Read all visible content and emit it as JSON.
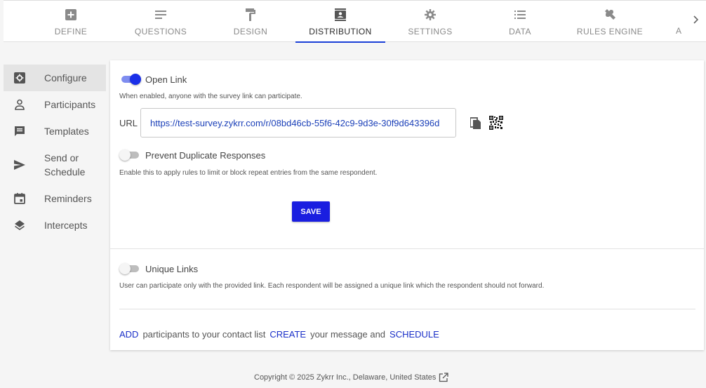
{
  "top_tabs": [
    {
      "label": "DEFINE",
      "icon": "plus-box-icon"
    },
    {
      "label": "QUESTIONS",
      "icon": "lines-icon"
    },
    {
      "label": "DESIGN",
      "icon": "paint-roller-icon"
    },
    {
      "label": "DISTRIBUTION",
      "icon": "contact-card-icon",
      "active": true
    },
    {
      "label": "SETTINGS",
      "icon": "gear-icon"
    },
    {
      "label": "DATA",
      "icon": "list-icon"
    },
    {
      "label": "RULES ENGINE",
      "icon": "wrench-icon"
    }
  ],
  "top_tab_partial": "A",
  "sidebar": {
    "items": [
      {
        "label": "Configure",
        "icon": "gear-box-icon",
        "active": true
      },
      {
        "label": "Participants",
        "icon": "person-icon"
      },
      {
        "label": "Templates",
        "icon": "message-icon"
      },
      {
        "label": "Send or Schedule",
        "icon": "send-icon"
      },
      {
        "label": "Reminders",
        "icon": "calendar-icon"
      },
      {
        "label": "Intercepts",
        "icon": "layers-icon"
      }
    ]
  },
  "main": {
    "open_link": {
      "label": "Open Link",
      "enabled": true,
      "hint": "When enabled, anyone with the survey link can participate."
    },
    "url_label": "URL",
    "url_value": "https://test-survey.zykrr.com/r/08bd46cb-55f6-42c9-9d3e-30f9d643396d",
    "prevent_duplicates": {
      "label": "Prevent Duplicate Responses",
      "enabled": false,
      "hint": "Enable this to apply rules to limit or block repeat entries from the same respondent."
    },
    "save_label": "SAVE",
    "unique_links": {
      "label": "Unique Links",
      "enabled": false,
      "hint": "User can participate only with the provided link. Each respondent will be assigned a unique link which the respondent should not forward."
    },
    "cta": {
      "add": "ADD",
      "text1": "participants to your contact list",
      "create": "CREATE",
      "text2": "your message and",
      "schedule": "SCHEDULE"
    }
  },
  "footer": {
    "copyright": "Copyright © 2025 Zykrr Inc., Delaware, United States"
  },
  "colors": {
    "accent": "#1a3fd6",
    "save_button": "#1a1ee0",
    "toggle_on": "#1a2fe8"
  }
}
